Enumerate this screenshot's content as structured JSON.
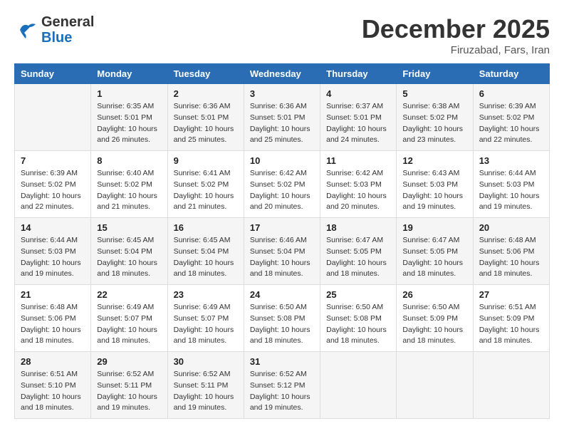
{
  "header": {
    "logo_line1": "General",
    "logo_line2": "Blue",
    "month": "December 2025",
    "location": "Firuzabad, Fars, Iran"
  },
  "weekdays": [
    "Sunday",
    "Monday",
    "Tuesday",
    "Wednesday",
    "Thursday",
    "Friday",
    "Saturday"
  ],
  "weeks": [
    [
      {
        "day": "",
        "sunrise": "",
        "sunset": "",
        "daylight": ""
      },
      {
        "day": "1",
        "sunrise": "6:35 AM",
        "sunset": "5:01 PM",
        "daylight": "10 hours and 26 minutes."
      },
      {
        "day": "2",
        "sunrise": "6:36 AM",
        "sunset": "5:01 PM",
        "daylight": "10 hours and 25 minutes."
      },
      {
        "day": "3",
        "sunrise": "6:36 AM",
        "sunset": "5:01 PM",
        "daylight": "10 hours and 25 minutes."
      },
      {
        "day": "4",
        "sunrise": "6:37 AM",
        "sunset": "5:01 PM",
        "daylight": "10 hours and 24 minutes."
      },
      {
        "day": "5",
        "sunrise": "6:38 AM",
        "sunset": "5:02 PM",
        "daylight": "10 hours and 23 minutes."
      },
      {
        "day": "6",
        "sunrise": "6:39 AM",
        "sunset": "5:02 PM",
        "daylight": "10 hours and 22 minutes."
      }
    ],
    [
      {
        "day": "7",
        "sunrise": "6:39 AM",
        "sunset": "5:02 PM",
        "daylight": "10 hours and 22 minutes."
      },
      {
        "day": "8",
        "sunrise": "6:40 AM",
        "sunset": "5:02 PM",
        "daylight": "10 hours and 21 minutes."
      },
      {
        "day": "9",
        "sunrise": "6:41 AM",
        "sunset": "5:02 PM",
        "daylight": "10 hours and 21 minutes."
      },
      {
        "day": "10",
        "sunrise": "6:42 AM",
        "sunset": "5:02 PM",
        "daylight": "10 hours and 20 minutes."
      },
      {
        "day": "11",
        "sunrise": "6:42 AM",
        "sunset": "5:03 PM",
        "daylight": "10 hours and 20 minutes."
      },
      {
        "day": "12",
        "sunrise": "6:43 AM",
        "sunset": "5:03 PM",
        "daylight": "10 hours and 19 minutes."
      },
      {
        "day": "13",
        "sunrise": "6:44 AM",
        "sunset": "5:03 PM",
        "daylight": "10 hours and 19 minutes."
      }
    ],
    [
      {
        "day": "14",
        "sunrise": "6:44 AM",
        "sunset": "5:03 PM",
        "daylight": "10 hours and 19 minutes."
      },
      {
        "day": "15",
        "sunrise": "6:45 AM",
        "sunset": "5:04 PM",
        "daylight": "10 hours and 18 minutes."
      },
      {
        "day": "16",
        "sunrise": "6:45 AM",
        "sunset": "5:04 PM",
        "daylight": "10 hours and 18 minutes."
      },
      {
        "day": "17",
        "sunrise": "6:46 AM",
        "sunset": "5:04 PM",
        "daylight": "10 hours and 18 minutes."
      },
      {
        "day": "18",
        "sunrise": "6:47 AM",
        "sunset": "5:05 PM",
        "daylight": "10 hours and 18 minutes."
      },
      {
        "day": "19",
        "sunrise": "6:47 AM",
        "sunset": "5:05 PM",
        "daylight": "10 hours and 18 minutes."
      },
      {
        "day": "20",
        "sunrise": "6:48 AM",
        "sunset": "5:06 PM",
        "daylight": "10 hours and 18 minutes."
      }
    ],
    [
      {
        "day": "21",
        "sunrise": "6:48 AM",
        "sunset": "5:06 PM",
        "daylight": "10 hours and 18 minutes."
      },
      {
        "day": "22",
        "sunrise": "6:49 AM",
        "sunset": "5:07 PM",
        "daylight": "10 hours and 18 minutes."
      },
      {
        "day": "23",
        "sunrise": "6:49 AM",
        "sunset": "5:07 PM",
        "daylight": "10 hours and 18 minutes."
      },
      {
        "day": "24",
        "sunrise": "6:50 AM",
        "sunset": "5:08 PM",
        "daylight": "10 hours and 18 minutes."
      },
      {
        "day": "25",
        "sunrise": "6:50 AM",
        "sunset": "5:08 PM",
        "daylight": "10 hours and 18 minutes."
      },
      {
        "day": "26",
        "sunrise": "6:50 AM",
        "sunset": "5:09 PM",
        "daylight": "10 hours and 18 minutes."
      },
      {
        "day": "27",
        "sunrise": "6:51 AM",
        "sunset": "5:09 PM",
        "daylight": "10 hours and 18 minutes."
      }
    ],
    [
      {
        "day": "28",
        "sunrise": "6:51 AM",
        "sunset": "5:10 PM",
        "daylight": "10 hours and 18 minutes."
      },
      {
        "day": "29",
        "sunrise": "6:52 AM",
        "sunset": "5:11 PM",
        "daylight": "10 hours and 19 minutes."
      },
      {
        "day": "30",
        "sunrise": "6:52 AM",
        "sunset": "5:11 PM",
        "daylight": "10 hours and 19 minutes."
      },
      {
        "day": "31",
        "sunrise": "6:52 AM",
        "sunset": "5:12 PM",
        "daylight": "10 hours and 19 minutes."
      },
      {
        "day": "",
        "sunrise": "",
        "sunset": "",
        "daylight": ""
      },
      {
        "day": "",
        "sunrise": "",
        "sunset": "",
        "daylight": ""
      },
      {
        "day": "",
        "sunrise": "",
        "sunset": "",
        "daylight": ""
      }
    ]
  ],
  "labels": {
    "sunrise_prefix": "Sunrise: ",
    "sunset_prefix": "Sunset: ",
    "daylight_prefix": "Daylight: "
  }
}
